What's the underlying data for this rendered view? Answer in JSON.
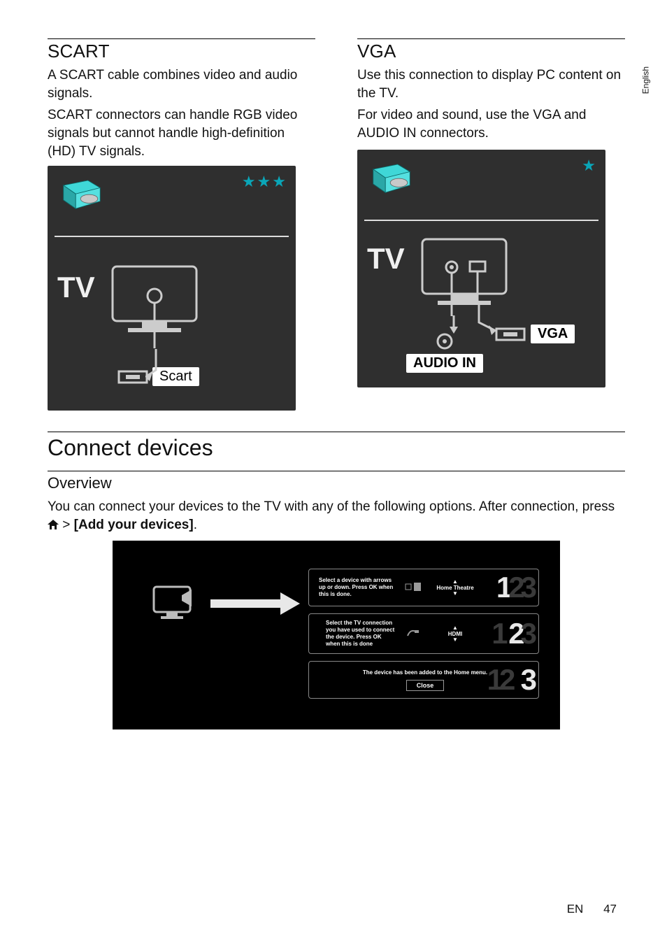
{
  "language_tab": "English",
  "left": {
    "heading": "SCART",
    "p1": "A SCART cable combines video and audio signals.",
    "p2": "SCART connectors can handle RGB video signals but cannot handle high-definition (HD) TV signals.",
    "fig": {
      "tv": "TV",
      "port": "Scart",
      "stars": "★★★"
    }
  },
  "right": {
    "heading": "VGA",
    "p1": "Use this connection to display PC content on the TV.",
    "p2": "For video and sound, use the VGA and AUDIO IN connectors.",
    "fig": {
      "tv": "TV",
      "port_vga": "VGA",
      "port_audio": "AUDIO IN",
      "stars": "★"
    }
  },
  "section": {
    "heading": "Connect devices",
    "sub": "Overview",
    "p1_a": "You can connect your devices to the TV with any of the following options. After connection, press ",
    "p1_b": " > ",
    "add": "[Add your devices]",
    "dot": "."
  },
  "overview_fig": {
    "step1": {
      "text": "Select a device with arrows up or down. Press OK when this is done.",
      "selection": "Home Theatre",
      "digits": "123"
    },
    "step2": {
      "text": "Select the TV connection you have used to connect the device. Press OK when this is done",
      "selection": "HDMI",
      "digits": "23"
    },
    "step3": {
      "text": "The device has been added to the Home menu.",
      "close": "Close",
      "digits": "3"
    }
  },
  "footer": {
    "lang": "EN",
    "page": "47"
  }
}
